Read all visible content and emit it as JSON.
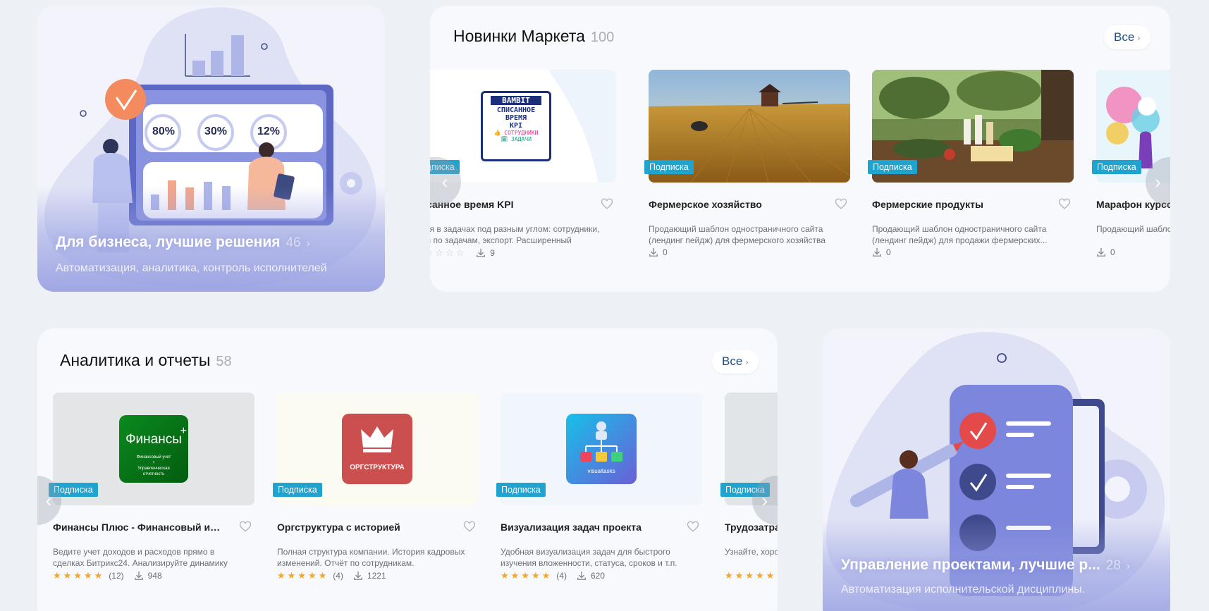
{
  "colors": {
    "badge": "#1fa3cf",
    "accent_blue": "#1c4f8f",
    "star": "#f5a623",
    "promo_purple": "#7d86d8"
  },
  "promo_business": {
    "title": "Для бизнеса, лучшие решения",
    "count": "46",
    "subtitle": "Автоматизация, аналитика, контроль исполнителей",
    "illustration": {
      "pct1": "80%",
      "pct2": "30%",
      "pct3": "12%"
    }
  },
  "market_new": {
    "title": "Новинки Маркета",
    "count": "100",
    "all_label": "Все",
    "cards": [
      {
        "badge": "Подписка",
        "title": "писанное время KPI",
        "desc": "ремя в задачах под разным углом: сотрудники, тоги по задачам, экспорт. Расширенный фильтр...",
        "downloads": "9",
        "logo": {
          "brand": "BAMBIT",
          "line1": "СПИСАННОЕ",
          "line2": "ВРЕМЯ",
          "line3": "KPI",
          "line4": "👍 СОТРУДНИКИ",
          "line5": "🗓 ЗАДАЧИ"
        }
      },
      {
        "badge": "Подписка",
        "title": "Фермерское хозяйство",
        "desc": "Продающий шаблон одностраничного сайта (лендинг пейдж) для фермерского хозяйства",
        "downloads": "0"
      },
      {
        "badge": "Подписка",
        "title": "Фермерские продукты",
        "desc": "Продающий шаблон одностраничного сайта (лендинг пейдж) для продажи фермерских...",
        "downloads": "0"
      },
      {
        "badge": "Подписка",
        "title": "Марафон курсо",
        "desc": "Продающий шабло (лендинг пейдж) дл",
        "downloads": "0"
      }
    ]
  },
  "analytics": {
    "title": "Аналитика и отчеты",
    "count": "58",
    "all_label": "Все",
    "cards": [
      {
        "badge": "Подписка",
        "title": "Финансы Плюс - Финансовый и упра...",
        "desc": "Ведите учет доходов и расходов прямо в сделках Битрикс24. Анализируйте динамику всего бизнес...",
        "rating_count": "(12)",
        "downloads": "948",
        "logo": {
          "name": "Финансы",
          "plus": "+",
          "l1": "Финансовый учет",
          "l2": "+",
          "l3": "Управленческая",
          "l4": "отчетность"
        }
      },
      {
        "badge": "Подписка",
        "title": "Оргструктура с историей",
        "desc": "Полная структура компании. История кадровых изменений. Отчёт по сотрудникам.",
        "rating_count": "(4)",
        "downloads": "1221",
        "logo": {
          "name": "ОРГСТРУКТУРА"
        }
      },
      {
        "badge": "Подписка",
        "title": "Визуализация задач проекта",
        "desc": "Удобная визуализация задач для быстрого изучения вложенности, статуса, сроков и т.п.",
        "rating_count": "(4)",
        "downloads": "620",
        "logo": {
          "name": "visualtasks"
        }
      },
      {
        "badge": "Подписка",
        "title": "Трудозатрат",
        "desc": "Узнайте, хоро",
        "rating_count": "",
        "downloads": ""
      }
    ]
  },
  "promo_projects": {
    "title": "Управление проектами, лучшие р...",
    "count": "28",
    "subtitle": "Автоматизация исполнительской дисциплины."
  }
}
